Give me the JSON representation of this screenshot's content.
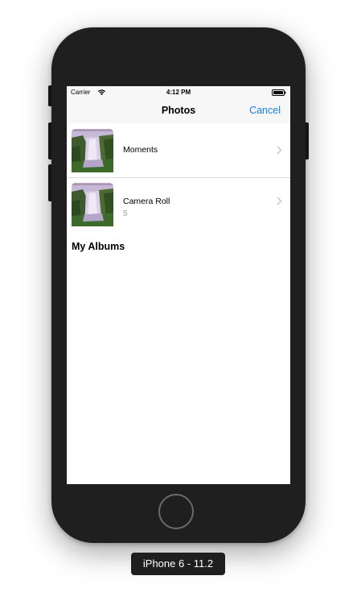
{
  "status_bar": {
    "carrier": "Carrier",
    "time": "4:12 PM",
    "wifi_icon": "wifi-icon",
    "battery_icon": "battery-icon"
  },
  "nav": {
    "title": "Photos",
    "cancel_label": "Cancel",
    "accent_color": "#1a7cf0"
  },
  "albums": [
    {
      "title": "Moments",
      "count": "",
      "thumbnail_icon": "waterfall-photo-thumbnail",
      "chevron_icon": "chevron-right-icon"
    },
    {
      "title": "Camera Roll",
      "count": "5",
      "thumbnail_icon": "waterfall-photo-thumbnail",
      "chevron_icon": "chevron-right-icon"
    }
  ],
  "sections": {
    "my_albums_title": "My Albums"
  },
  "device": {
    "label": "iPhone 6 - 11.2"
  }
}
